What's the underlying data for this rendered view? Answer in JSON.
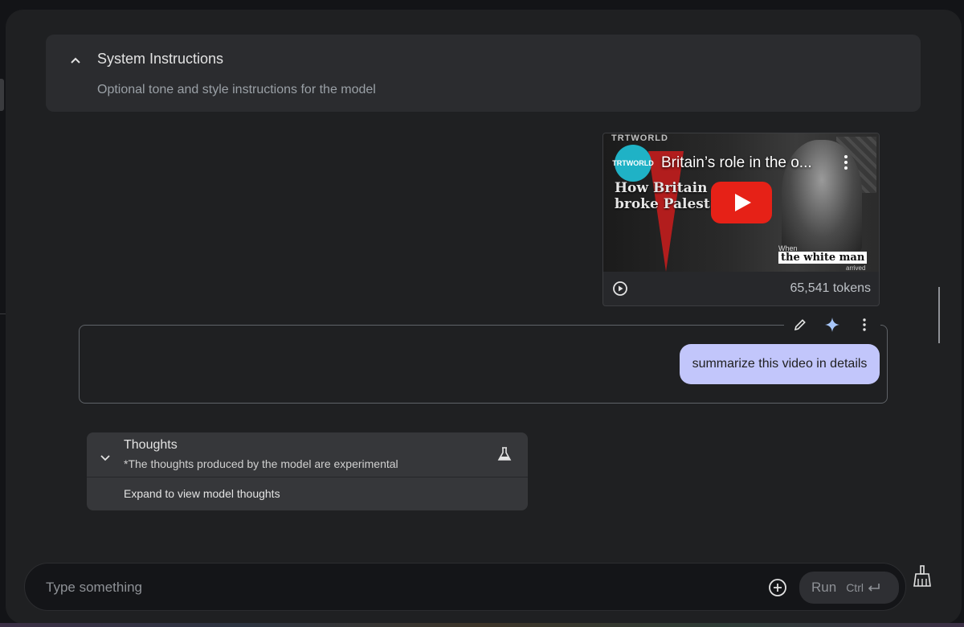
{
  "system_instructions": {
    "title": "System Instructions",
    "placeholder": "Optional tone and style instructions for the model"
  },
  "video": {
    "brand": "TRTWORLD",
    "channel_label": "TRTWORLD",
    "title": "Britain’s role in the o...",
    "overlay_line1": "How Britain",
    "overlay_line2": "broke Palest",
    "caption_when": "When",
    "caption_main": "the white man",
    "caption_after": "arrived",
    "tokens": "65,541 tokens"
  },
  "user_message": {
    "text": "summarize this video in details"
  },
  "thoughts": {
    "title": "Thoughts",
    "subtitle": "*The thoughts produced by the model are experimental",
    "expand_label": "Expand to view model thoughts"
  },
  "input": {
    "placeholder": "Type something",
    "run_label": "Run",
    "shortcut": "Ctrl"
  },
  "colors": {
    "background": "#1f2022",
    "bubble": "#c2c6fb",
    "accent_sparkle": "#a8c7fa",
    "play_red": "#e62117"
  },
  "icons": [
    "chevron-up-icon",
    "play-circle-icon",
    "pencil-icon",
    "sparkle-icon",
    "more-vert-icon",
    "chevron-down-icon",
    "flask-icon",
    "add-circle-icon",
    "enter-icon",
    "broom-icon"
  ]
}
